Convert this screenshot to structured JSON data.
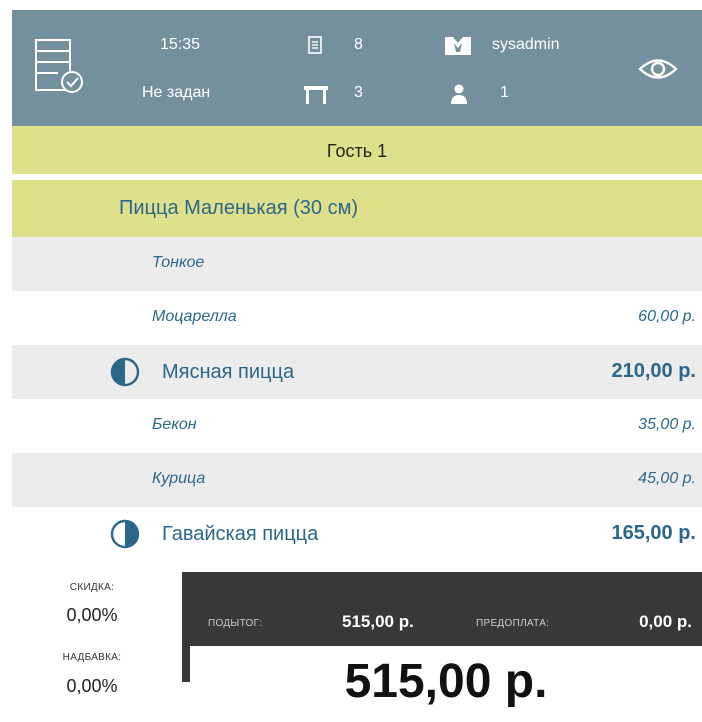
{
  "header": {
    "time": "15:35",
    "status": "Не задан",
    "order_count": "8",
    "table": "3",
    "user": "sysadmin",
    "guests": "1"
  },
  "guest": {
    "label": "Гость 1"
  },
  "pizza": {
    "label": "Пицца Маленькая (30 см)"
  },
  "lines": [
    {
      "name": "Тонкое",
      "price": ""
    },
    {
      "name": "Моцарелла",
      "price": "60,00 р."
    },
    {
      "name": "Мясная пицца",
      "price": "210,00 р."
    },
    {
      "name": "Бекон",
      "price": "35,00 р."
    },
    {
      "name": "Курица",
      "price": "45,00 р."
    },
    {
      "name": "Гавайская пицца",
      "price": "165,00 р."
    }
  ],
  "footer": {
    "discount_label": "СКИДКА:",
    "discount_value": "0,00%",
    "surcharge_label": "НАДБАВКА:",
    "surcharge_value": "0,00%",
    "subtotal_label": "ПОДЫТОГ:",
    "subtotal_value": "515,00 р.",
    "prepay_label": "ПРЕДОПЛАТА:",
    "prepay_value": "0,00 р.",
    "total": "515,00 р."
  },
  "colors": {
    "header": "#74909c",
    "accent": "#2b6789",
    "highlight": "#dfe08b",
    "dark": "#383838"
  }
}
